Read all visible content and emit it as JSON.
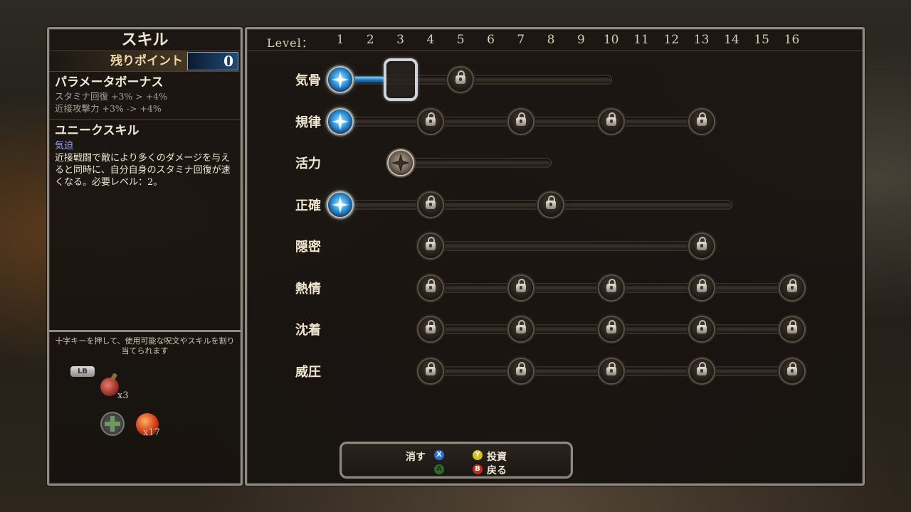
{
  "left_panel": {
    "title": "スキル",
    "points_label": "残りポイント",
    "points_value": "0",
    "bonus_title": "パラメータボーナス",
    "bonus_lines": [
      "スタミナ回復 +3% > +4%",
      "近接攻撃力 +3% -> +4%"
    ],
    "unique_title": "ユニークスキル",
    "unique_name": "気迫",
    "unique_desc": "近接戦闘で敵により多くのダメージを与えると同時に、自分自身のスタミナ回復が速くなる。必要レベル：2。",
    "quick_hint": "十字キーを押して、使用可能な呪文やスキルを割り当てられます",
    "lb_label": "LB",
    "potion_count": "x3",
    "apple_count": "x17"
  },
  "header": {
    "level_label": "Level：",
    "levels": [
      "1",
      "2",
      "3",
      "4",
      "5",
      "6",
      "7",
      "8",
      "9",
      "10",
      "11",
      "12",
      "13",
      "14",
      "15",
      "16"
    ]
  },
  "skills": [
    {
      "name": "気骨",
      "bar_start": 1,
      "bar_end": 10,
      "filled_to": 2.5,
      "active_nodes": [
        1
      ],
      "unlocked_nodes": [],
      "locked_nodes": [
        5
      ]
    },
    {
      "name": "規律",
      "bar_start": 1,
      "bar_end": 13,
      "filled_to": 1.2,
      "active_nodes": [
        1
      ],
      "unlocked_nodes": [],
      "locked_nodes": [
        4,
        7,
        10,
        13
      ]
    },
    {
      "name": "活力",
      "bar_start": 3,
      "bar_end": 8,
      "filled_to": 0,
      "active_nodes": [],
      "unlocked_nodes": [
        3
      ],
      "locked_nodes": []
    },
    {
      "name": "正確",
      "bar_start": 1,
      "bar_end": 14,
      "filled_to": 1.2,
      "active_nodes": [
        1
      ],
      "unlocked_nodes": [],
      "locked_nodes": [
        4,
        8
      ]
    },
    {
      "name": "隠密",
      "bar_start": 4,
      "bar_end": 13,
      "filled_to": 0,
      "active_nodes": [],
      "unlocked_nodes": [],
      "locked_nodes": [
        4,
        13
      ]
    },
    {
      "name": "熱情",
      "bar_start": 4,
      "bar_end": 16,
      "filled_to": 0,
      "active_nodes": [],
      "unlocked_nodes": [],
      "locked_nodes": [
        4,
        7,
        10,
        13,
        16
      ]
    },
    {
      "name": "沈着",
      "bar_start": 4,
      "bar_end": 16,
      "filled_to": 0,
      "active_nodes": [],
      "unlocked_nodes": [],
      "locked_nodes": [
        4,
        7,
        10,
        13,
        16
      ]
    },
    {
      "name": "威圧",
      "bar_start": 4,
      "bar_end": 16,
      "filled_to": 0,
      "active_nodes": [],
      "unlocked_nodes": [],
      "locked_nodes": [
        4,
        7,
        10,
        13,
        16
      ]
    }
  ],
  "cursor_level": 3,
  "buttons": {
    "erase_label": "消す",
    "erase_btn": "X",
    "invest_label": "投資",
    "invest_btn": "Y",
    "back_label": "戻る",
    "back_btn": "B",
    "a_btn": "A",
    "colors": {
      "X": "#2a6fd6",
      "Y": "#d8c21a",
      "B": "#c8281e",
      "A": "#2f6a2a"
    }
  }
}
